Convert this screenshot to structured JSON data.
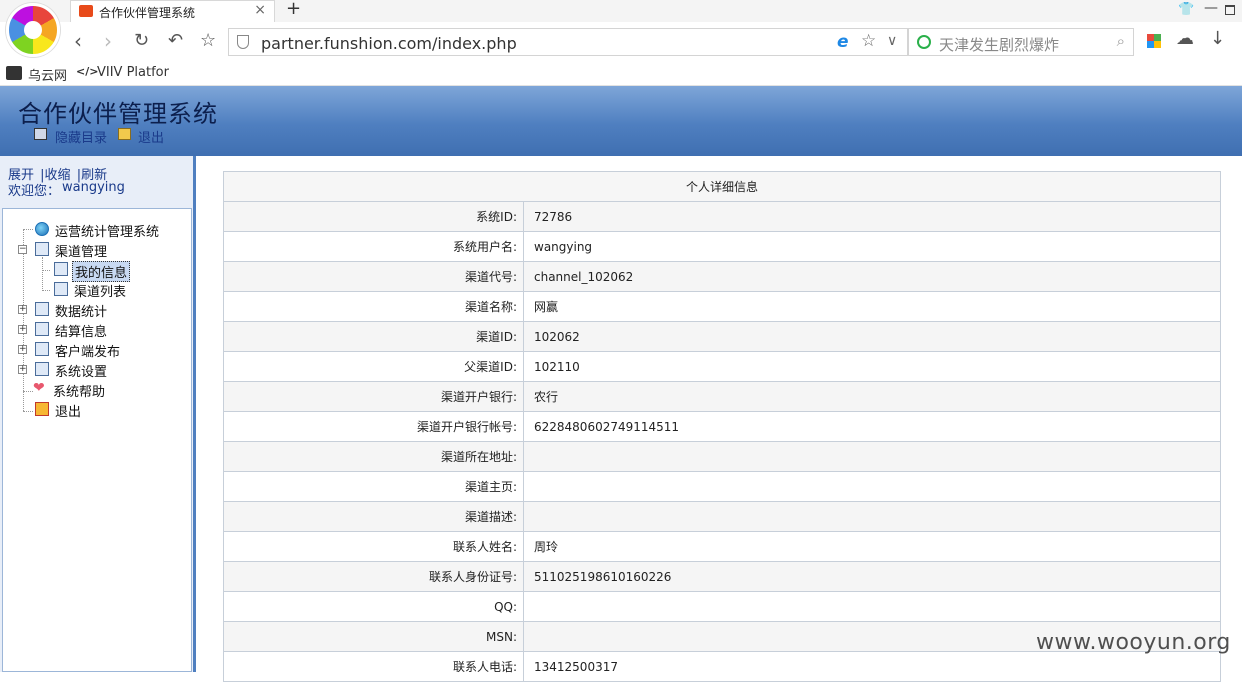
{
  "browser": {
    "tab_title": "合作伙伴管理系统",
    "tab_close": "×",
    "new_tab": "+",
    "url": "partner.funshion.com/index.php",
    "search_placeholder": "天津发生剧烈爆炸",
    "bookmarks": [
      "乌云网",
      "VIIV Platfor"
    ],
    "bookmark2_icon": "</>"
  },
  "header": {
    "title": "合作伙伴管理系统",
    "hide_menu": "隐藏目录",
    "logout": "退出"
  },
  "sidebar": {
    "actions": [
      "展开",
      "|收缩",
      "|刷新"
    ],
    "welcome_label": "欢迎您：",
    "username": "wangying",
    "tree": [
      {
        "label": "运营统计管理系统",
        "icon": "globe-icon"
      },
      {
        "label": "渠道管理",
        "icon": "folder-icon",
        "expanded": true
      },
      {
        "label": "我的信息",
        "icon": "page-icon",
        "selected": true
      },
      {
        "label": "渠道列表",
        "icon": "page-icon"
      },
      {
        "label": "数据统计",
        "icon": "chart-icon"
      },
      {
        "label": "结算信息",
        "icon": "folder-icon"
      },
      {
        "label": "客户端发布",
        "icon": "folder-icon"
      },
      {
        "label": "系统设置",
        "icon": "folder-icon"
      },
      {
        "label": "系统帮助",
        "icon": "heart-icon"
      },
      {
        "label": "退出",
        "icon": "exit-icon"
      }
    ]
  },
  "profile": {
    "heading": "个人详细信息",
    "rows": [
      {
        "label": "系统ID:",
        "value": "72786"
      },
      {
        "label": "系统用户名:",
        "value": "wangying"
      },
      {
        "label": "渠道代号:",
        "value": "channel_102062"
      },
      {
        "label": "渠道名称:",
        "value": "网赢"
      },
      {
        "label": "渠道ID:",
        "value": "102062"
      },
      {
        "label": "父渠道ID:",
        "value": "102110"
      },
      {
        "label": "渠道开户银行:",
        "value": "农行"
      },
      {
        "label": "渠道开户银行帐号:",
        "value": "6228480602749114511"
      },
      {
        "label": "渠道所在地址:",
        "value": ""
      },
      {
        "label": "渠道主页:",
        "value": ""
      },
      {
        "label": "渠道描述:",
        "value": ""
      },
      {
        "label": "联系人姓名:",
        "value": "周玲"
      },
      {
        "label": "联系人身份证号:",
        "value": "511025198610160226"
      },
      {
        "label": "QQ:",
        "value": ""
      },
      {
        "label": "MSN:",
        "value": ""
      },
      {
        "label": "联系人电话:",
        "value": "13412500317"
      }
    ]
  },
  "watermark": "www.wooyun.org",
  "colors": {
    "header_top": "#7ea6d8",
    "header_bottom": "#3f6fb1",
    "sidebar_bg": "#e8eef8",
    "link": "#1a3a8a"
  }
}
